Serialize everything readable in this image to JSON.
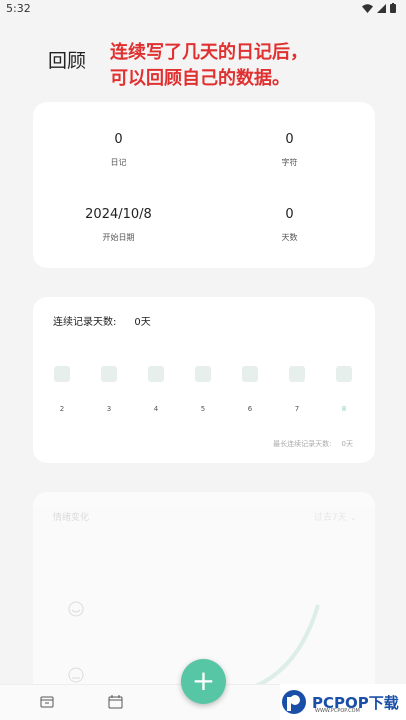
{
  "status": {
    "time": "5:32"
  },
  "header": {
    "title": "回顾"
  },
  "annotation": "连续写了几天的日记后，\n可以回顾自己的数据。",
  "summary": [
    {
      "value": "0",
      "label": "日记"
    },
    {
      "value": "0",
      "label": "字符"
    },
    {
      "value": "2024/10/8",
      "label": "开始日期"
    },
    {
      "value": "0",
      "label": "天数"
    }
  ],
  "streak": {
    "label": "连续记录天数:",
    "value": "0天",
    "days": [
      "2",
      "3",
      "4",
      "5",
      "6",
      "7",
      "8"
    ],
    "max_label": "最长连续记录天数:",
    "max_value": "0天"
  },
  "mood": {
    "title": "情绪变化",
    "range": "过去7天"
  },
  "fab": {
    "label": "+"
  },
  "watermark": {
    "brand": "PCPOP下载",
    "sub": "WWW.PCPOP.COM"
  },
  "colors": {
    "accent": "#57c6a4",
    "annotation": "#e03030"
  }
}
